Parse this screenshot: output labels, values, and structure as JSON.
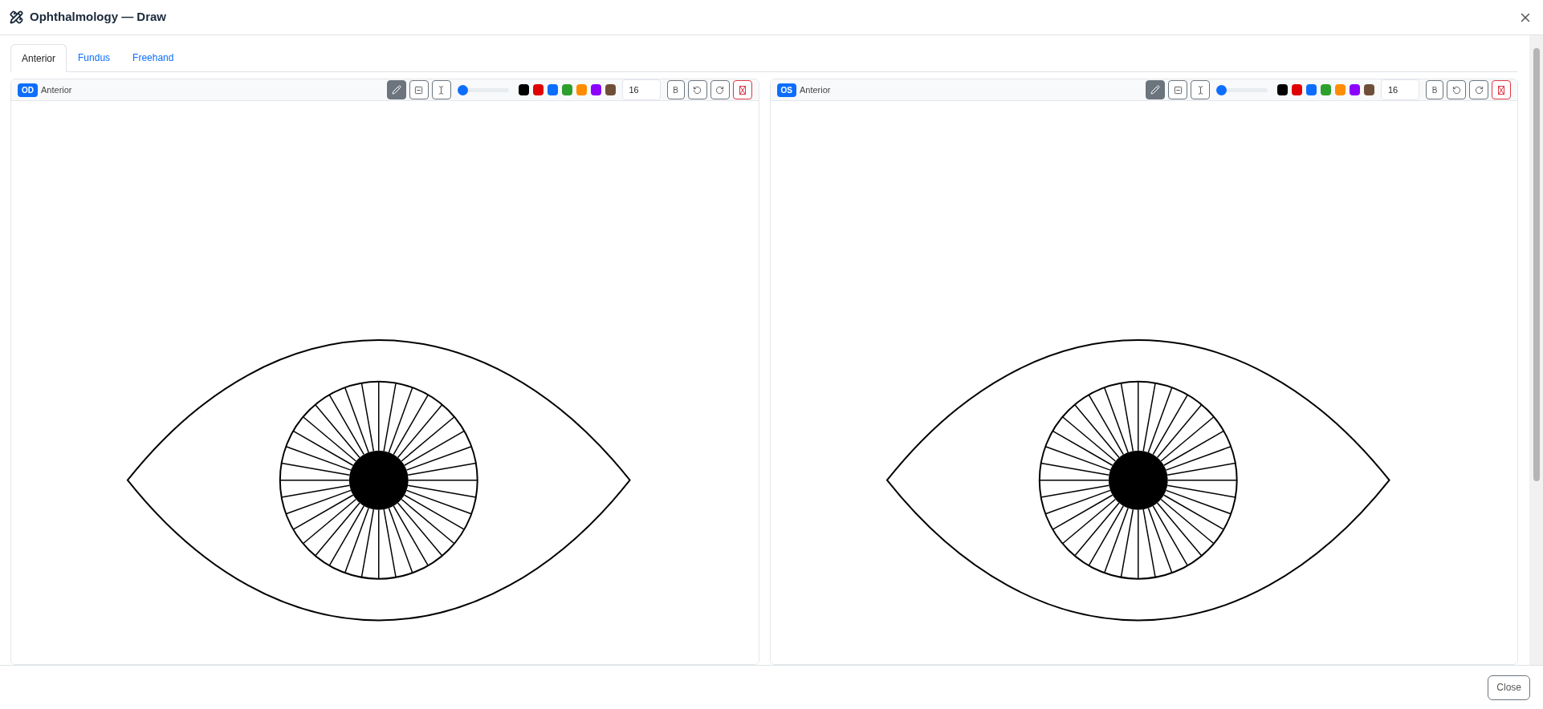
{
  "window": {
    "title": "Ophthalmology — Draw"
  },
  "tabs": [
    {
      "label": "Anterior",
      "selected": true
    },
    {
      "label": "Fundus",
      "selected": false
    },
    {
      "label": "Freehand",
      "selected": false
    }
  ],
  "panels": [
    {
      "eye_badge": "OD",
      "view_label": "Anterior",
      "tools": [
        {
          "kind": "pen",
          "selected": true
        },
        {
          "kind": "eraser",
          "selected": false
        },
        {
          "kind": "text",
          "selected": false
        }
      ],
      "size": {
        "level": 0.05
      },
      "colors": [
        {
          "color": "#000000"
        },
        {
          "color": "#e00000"
        },
        {
          "color": "#0d6efd"
        },
        {
          "color": "#2ca02c"
        },
        {
          "color": "#ff8c00"
        },
        {
          "color": "#8b00ff"
        },
        {
          "color": "#6f4e37"
        }
      ],
      "font_size": "16",
      "bold_label": "B"
    },
    {
      "eye_badge": "OS",
      "view_label": "Anterior",
      "tools": [
        {
          "kind": "pen",
          "selected": true
        },
        {
          "kind": "eraser",
          "selected": false
        },
        {
          "kind": "text",
          "selected": false
        }
      ],
      "size": {
        "level": 0.05
      },
      "colors": [
        {
          "color": "#000000"
        },
        {
          "color": "#e00000"
        },
        {
          "color": "#0d6efd"
        },
        {
          "color": "#2ca02c"
        },
        {
          "color": "#ff8c00"
        },
        {
          "color": "#8b00ff"
        },
        {
          "color": "#6f4e37"
        }
      ],
      "font_size": "16",
      "bold_label": "B"
    }
  ],
  "footer": {
    "close_label": "Close"
  }
}
